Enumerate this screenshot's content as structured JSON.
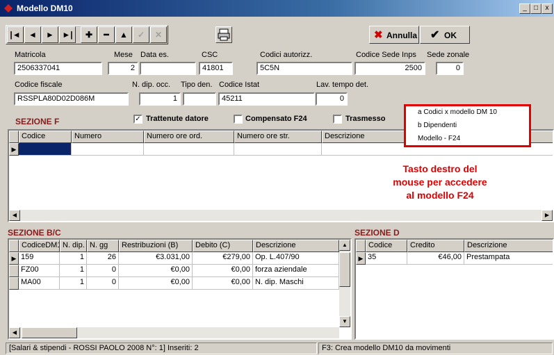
{
  "window": {
    "title": "Modello DM10",
    "controls": [
      "_",
      "□",
      "x"
    ]
  },
  "toolbar": {
    "nav": [
      "|◄",
      "◄",
      "►",
      "►|",
      "✚",
      "━",
      "▲",
      "✓",
      "✕"
    ],
    "annulla_label": "Annulla",
    "ok_label": "OK"
  },
  "form": {
    "matricola_label": "Matricola",
    "matricola": "2506337041",
    "mese_label": "Mese",
    "mese": "2",
    "data_es_label": "Data es.",
    "data_es": "",
    "csc_label": "CSC",
    "csc": "41801",
    "codici_autorizz_label": "Codici autorizz.",
    "codici_autorizz": "5C5N",
    "codice_sede_inps_label": "Codice Sede Inps",
    "codice_sede_inps": "2500",
    "sede_zonale_label": "Sede zonale",
    "sede_zonale": "0",
    "codice_fiscale_label": "Codice fiscale",
    "codice_fiscale": "RSSPLA80D02D086M",
    "n_dip_occ_label": "N. dip. occ.",
    "n_dip_occ": "1",
    "tipo_den_label": "Tipo den.",
    "tipo_den": "",
    "codice_istat_label": "Codice Istat",
    "codice_istat": "45211",
    "lav_tempo_det_label": "Lav. tempo det.",
    "lav_tempo_det": "0"
  },
  "sezione_f": {
    "title": "SEZIONE F",
    "trattenute_label": "Trattenute datore",
    "trattenute_checked": true,
    "compensato_label": "Compensato F24",
    "compensato_checked": false,
    "trasmesso_label": "Trasmesso",
    "trasmesso_checked": false,
    "columns": [
      "Codice",
      "Numero",
      "Numero ore ord.",
      "Numero ore str.",
      "Descrizione"
    ]
  },
  "context_menu": {
    "items": [
      "a Codici x modello DM 10",
      "b Dipendenti",
      "Modello - F24"
    ],
    "border_color": "#e00000"
  },
  "annotation": {
    "line1": "Tasto destro del",
    "line2": "mouse per accedere",
    "line3": "al modello F24",
    "color": "#e00000"
  },
  "sezione_bc": {
    "title": "SEZIONE B/C",
    "columns": [
      "CodiceDM10",
      "N. dip.",
      "N. gg",
      "Restribuzioni (B)",
      "Debito (C)",
      "Descrizione"
    ],
    "rows": [
      [
        "159",
        "1",
        "26",
        "€3.031,00",
        "€279,00",
        "Op. L.407/90"
      ],
      [
        "FZ00",
        "1",
        "0",
        "€0,00",
        "€0,00",
        "forza aziendale"
      ],
      [
        "MA00",
        "1",
        "0",
        "€0,00",
        "€0,00",
        "N. dip. Maschi"
      ]
    ]
  },
  "sezione_d": {
    "title": "SEZIONE D",
    "columns": [
      "Codice",
      "Credito",
      "Descrizione"
    ],
    "rows": [
      [
        "35",
        "€46,00",
        "Prestampata"
      ]
    ]
  },
  "status": {
    "left": "[Salari & stipendi - ROSSI PAOLO 2008 N°: 1]  Inseriti: 2",
    "right": "F3: Crea modello DM10 da movimenti"
  }
}
